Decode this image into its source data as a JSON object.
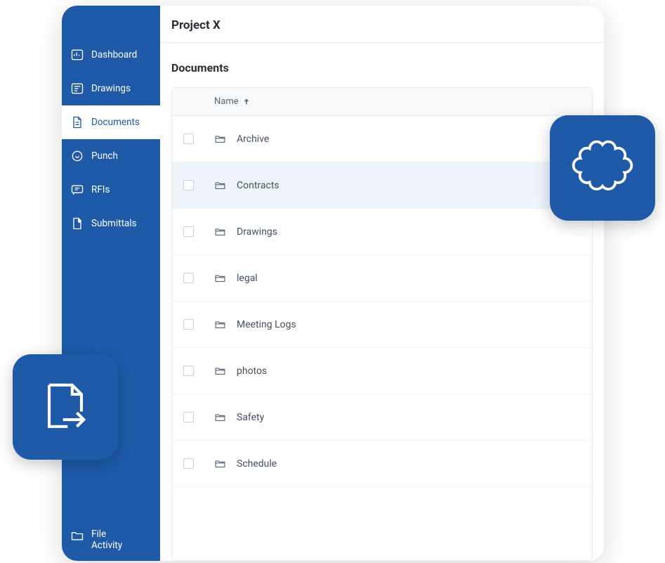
{
  "header": {
    "title": "Project X"
  },
  "section": {
    "title": "Documents"
  },
  "sidebar": {
    "items": [
      {
        "label": "Dashboard",
        "icon": "dashboard-icon",
        "active": false
      },
      {
        "label": "Drawings",
        "icon": "drawings-icon",
        "active": false
      },
      {
        "label": "Documents",
        "icon": "document-icon",
        "active": true
      },
      {
        "label": "Punch",
        "icon": "punch-icon",
        "active": false
      },
      {
        "label": "RFIs",
        "icon": "rfi-icon",
        "active": false
      },
      {
        "label": "Submittals",
        "icon": "submittal-icon",
        "active": false
      }
    ],
    "footer": {
      "label": "File\nActivity",
      "icon": "folder-icon"
    }
  },
  "table": {
    "columns": {
      "name": "Name"
    },
    "sort": {
      "column": "name",
      "direction": "asc"
    },
    "rows": [
      {
        "name": "Archive",
        "highlight": false
      },
      {
        "name": "Contracts",
        "highlight": true
      },
      {
        "name": "Drawings",
        "highlight": false
      },
      {
        "name": "legal",
        "highlight": false
      },
      {
        "name": "Meeting Logs",
        "highlight": false
      },
      {
        "name": "photos",
        "highlight": false
      },
      {
        "name": "Safety",
        "highlight": false
      },
      {
        "name": "Schedule",
        "highlight": false
      }
    ]
  },
  "badges": {
    "left": "file-export-icon",
    "right": "cloud-scallop-icon"
  }
}
